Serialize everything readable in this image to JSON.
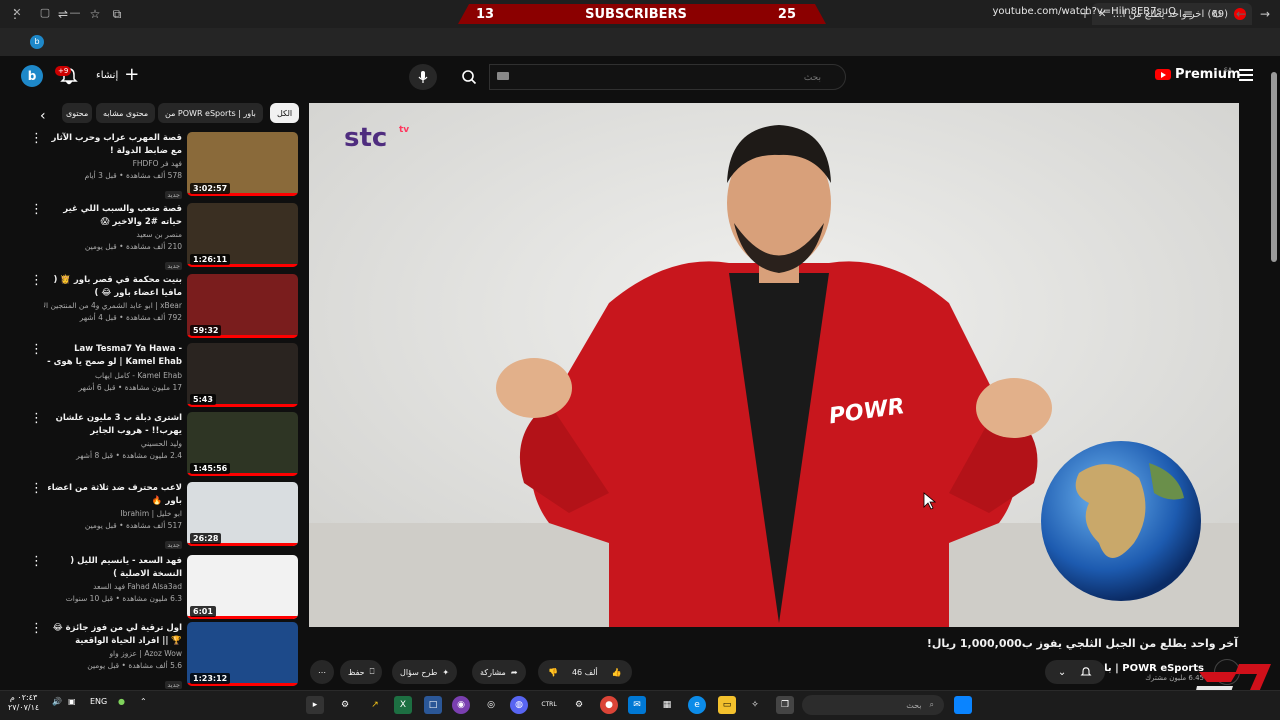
{
  "window": {
    "subscriber_banner": {
      "left_count": "13",
      "label": "SUBSCRIBERS",
      "right_count": "25"
    },
    "tab": {
      "title": "(69) آخر واحد يطلع من الجبل الثلـ",
      "close": "✕"
    },
    "new_tab": "+"
  },
  "address_bar": {
    "url": "youtube.com/watch?v=Hiln8ER7suQ"
  },
  "header": {
    "avatar_letter": "b",
    "notifications_badge": "+9",
    "create_label": "إنشاء",
    "search_placeholder": "بحث",
    "premium_label": "Premium",
    "region": "SA"
  },
  "chips": {
    "items": [
      "الكل",
      "من POWR eSports | باور",
      "محتوى مشابه",
      "محتوى"
    ]
  },
  "recommendations": [
    {
      "title": "قصة المهرب عراب وحرب الآثار مع ضابط الدولة !",
      "channel": "فهد فر FHDFO",
      "views": "578 ألف مشاهدة • قبل 3 أيام",
      "badge": "جديد",
      "duration": "3:02:57",
      "thumb_color": "#8a6a3a"
    },
    {
      "title": "قصة متعب والسبب اللي غير حياته #2 والاخير 😱",
      "channel": "منصر بن سعيد",
      "views": "210 ألف مشاهدة • قبل يومين",
      "badge": "جديد",
      "duration": "1:26:11",
      "thumb_color": "#3a2f22"
    },
    {
      "title": "بنيت محكمة في قصر باور 👸 ( مافيا اعضاء باور 😂 )",
      "channel": "xBear | ابو عابد الشمري و4 من المنتجين الآخرين",
      "views": "792 ألف مشاهدة • قبل 4 أشهر",
      "badge": "",
      "duration": "59:32",
      "thumb_color": "#7a1d1d"
    },
    {
      "title": "Law Tesma7 Ya Hawa - Kamel Ehab | لو صمح يا هوى - كامل ايهاب",
      "channel": "Kamel Ehab - كامل ايهاب",
      "views": "17 مليون مشاهدة • قبل 6 أشهر",
      "badge": "",
      "duration": "5:43",
      "thumb_color": "#2a2420"
    },
    {
      "title": "اشترى دبلة ب 3 مليون علشان يهرب!! - هروب الجاير",
      "channel": "وليد الحسيني",
      "views": "2.4 مليون مشاهدة • قبل 8 أشهر",
      "badge": "",
      "duration": "1:45:56",
      "thumb_color": "#2e3524"
    },
    {
      "title": "لاعب محترف ضد ثلاثة من اعضاء باور 🔥",
      "channel": "ابو خليل | Ibrahim",
      "views": "517 ألف مشاهدة • قبل يومين",
      "badge": "جديد",
      "duration": "26:28",
      "thumb_color": "#d9dde0"
    },
    {
      "title": "فهد السعد - يانسيم الليل ( النسخة الاصلية )",
      "channel": "Fahad Alsa3ad فهد السعد",
      "views": "6.3 مليون مشاهدة • قبل 10 سنوات",
      "badge": "",
      "duration": "6:01",
      "thumb_color": "#f2f2f2"
    },
    {
      "title": "اول ترقية لي من فوز جائزة 😂🏆 || افراد الحياة الواقعية",
      "channel": "Azoz Wow | عزوز واو",
      "views": "5.6 ألف مشاهدة • قبل يومين",
      "badge": "جديد",
      "duration": "1:23:12",
      "thumb_color": "#1d4a8a"
    }
  ],
  "video": {
    "title": "آخر واحد يطلع من الجبل الثلجي يفوز ب1,000,000 ريال!",
    "watermark": "stc",
    "watermark_sub": "tv",
    "channel": "POWR eSports | باور",
    "channel_subs": "6.45 مليون مشترك",
    "likes": "46 ألف",
    "share_label": "مشاركة",
    "ask_label": "طرح سؤال",
    "save_label": "حفظ",
    "jacket_text": "POWR"
  },
  "taskbar": {
    "search_placeholder": "بحث",
    "lang": "ENG",
    "time": "٠٢:٤٣ م",
    "date": "٢٧/٠٧/١٤"
  },
  "colors": {
    "accent": "#ff0000",
    "banner": "#8b0000",
    "background": "#0f0f0f"
  }
}
